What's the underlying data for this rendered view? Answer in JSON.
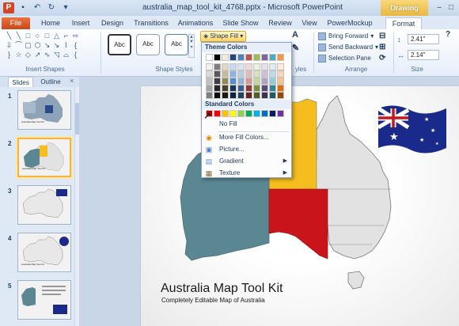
{
  "window": {
    "title": "australia_map_tool_kit_4768.pptx - Microsoft PowerPoint",
    "app_icon": "P",
    "contextual_tab": "Drawing Tools"
  },
  "tabs": [
    "File",
    "Home",
    "Insert",
    "Design",
    "Transitions",
    "Animations",
    "Slide Show",
    "Review",
    "View",
    "PowerMockup",
    "Format"
  ],
  "ribbon": {
    "insert_shapes_label": "Insert Shapes",
    "shape_styles_label": "Shape Styles",
    "style_sample": "Abc",
    "shape_fill_label": "Shape Fill",
    "wordart_label": "yles",
    "arrange_label": "Arrange",
    "size_label": "Size",
    "bring_forward": "Bring Forward",
    "send_backward": "Send Backward",
    "selection_pane": "Selection Pane",
    "height": "2.41\"",
    "width": "2.14\""
  },
  "shape_fill_menu": {
    "theme_colors_heading": "Theme Colors",
    "standard_colors_heading": "Standard Colors",
    "no_fill": "No Fill",
    "more_fill_colors": "More Fill Colors...",
    "picture": "Picture...",
    "gradient": "Gradient",
    "texture": "Texture",
    "theme_colors": [
      [
        "#ffffff",
        "#000000",
        "#eeece1",
        "#1f497d",
        "#4f81bd",
        "#c0504d",
        "#9bbb59",
        "#8064a2",
        "#4bacc6",
        "#f79646"
      ],
      [
        "#f2f2f2",
        "#7f7f7f",
        "#ddd9c3",
        "#c6d9f0",
        "#dbe5f1",
        "#f2dcdb",
        "#ebf1dd",
        "#e5e0ec",
        "#dbeef3",
        "#fdeada"
      ],
      [
        "#d8d8d8",
        "#595959",
        "#c4bd97",
        "#8db3e2",
        "#b8cce4",
        "#e5b9b7",
        "#d7e3bc",
        "#ccc1d9",
        "#b7dde8",
        "#fbd5b5"
      ],
      [
        "#bfbfbf",
        "#3f3f3f",
        "#938953",
        "#548dd4",
        "#95b3d7",
        "#d99694",
        "#c3d69b",
        "#b2a2c7",
        "#92cddc",
        "#fac08f"
      ],
      [
        "#a5a5a5",
        "#262626",
        "#494429",
        "#17365d",
        "#366092",
        "#953734",
        "#76923c",
        "#5f497a",
        "#31859b",
        "#e36c09"
      ],
      [
        "#7f7f7f",
        "#0c0c0c",
        "#1d1b10",
        "#0f243e",
        "#244061",
        "#632423",
        "#4f6128",
        "#3f3151",
        "#205867",
        "#974806"
      ]
    ],
    "standard_colors": [
      "#c00000",
      "#ff0000",
      "#ffc000",
      "#ffff00",
      "#92d050",
      "#00b050",
      "#00b0f0",
      "#0070c0",
      "#002060",
      "#7030a0"
    ]
  },
  "slides_pane": {
    "tab_slides": "Slides",
    "tab_outline": "Outline",
    "close": "×",
    "thumbnails": [
      {
        "number": "1",
        "title": "Australia Map Tool Kit"
      },
      {
        "number": "2",
        "title": "Australia Map Tool Kit"
      },
      {
        "number": "3",
        "title": ""
      },
      {
        "number": "4",
        "title": "Australia Map Tool Kit"
      },
      {
        "number": "5",
        "title": ""
      }
    ]
  },
  "slide": {
    "title": "Australia Map Tool Kit",
    "subtitle": "Completely Editable Map of Australia"
  },
  "colors": {
    "wa_state": "#5b8793",
    "nt_state": "#f5bd1d",
    "sa_state": "#c8141a",
    "other_states": "#e2e2e2",
    "flag_blue": "#1a2a8a",
    "accent_file_tab": "#d24726"
  }
}
